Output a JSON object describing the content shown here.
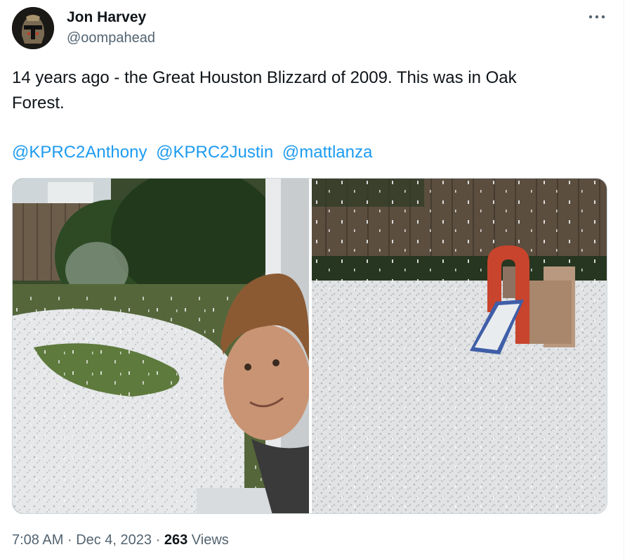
{
  "author": {
    "name": "Jon Harvey",
    "handle": "@oompahead",
    "avatar_icon": "helmet-avatar-icon"
  },
  "menu": {
    "icon": "more-horizontal-icon"
  },
  "tweet": {
    "line1": "14 years ago - the Great Houston Blizzard of 2009.  This was in Oak",
    "line2": "Forest.",
    "mentions": [
      "@KPRC2Anthony",
      "@KPRC2Justin",
      "@mattlanza"
    ]
  },
  "media": {
    "photo_count": 2
  },
  "footer": {
    "time": "7:08 AM",
    "separator": "·",
    "date": "Dec 4, 2023",
    "views_count": "263",
    "views_label": "Views"
  },
  "colors": {
    "link": "#1d9bf0",
    "secondary_text": "#536471",
    "primary_text": "#0f1419",
    "border": "#cfd9de"
  }
}
